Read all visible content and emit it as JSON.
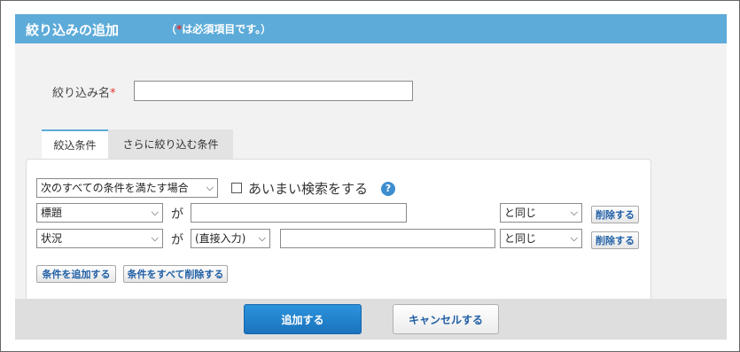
{
  "dialog": {
    "title": "絞り込みの追加",
    "note_open": "（",
    "note_star": "*",
    "note_text": "は必須項目です。）"
  },
  "form": {
    "name_label": "絞り込み名",
    "required_mark": "*",
    "name_value": ""
  },
  "tabs": [
    {
      "label": "絞込条件",
      "active": true
    },
    {
      "label": "さらに絞り込む条件",
      "active": false
    }
  ],
  "conditions": {
    "match_mode": "次のすべての条件を満たす場合",
    "fuzzy_label": "あいまい検索をする",
    "help_icon": "question-circle-icon",
    "ga": "が",
    "rows": [
      {
        "field": "標題",
        "input_type": "",
        "value": "",
        "operator": "と同じ",
        "delete_label": "削除する"
      },
      {
        "field": "状況",
        "input_type": "(直接入力)",
        "value": "",
        "operator": "と同じ",
        "delete_label": "削除する"
      }
    ],
    "add_condition_label": "条件を追加する",
    "delete_all_label": "条件をすべて削除する"
  },
  "footer": {
    "add_label": "追加する",
    "cancel_label": "キャンセルする"
  },
  "colors": {
    "header": "#5dabd9",
    "primary_button": "#1b73bd",
    "required": "#e4322b"
  }
}
